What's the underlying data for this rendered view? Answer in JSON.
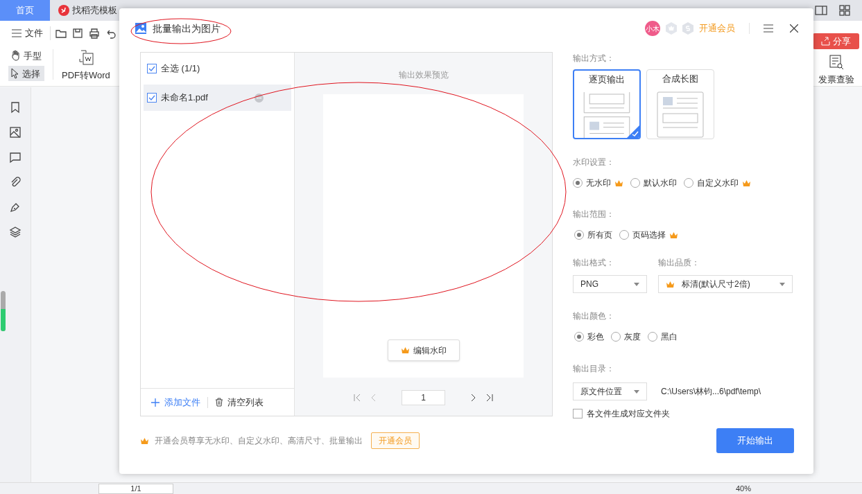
{
  "app": {
    "tabs": [
      {
        "label": "首页",
        "selected": true
      },
      {
        "label": "找稻壳模板",
        "selected": false
      }
    ],
    "menu": "文件",
    "tools": [
      {
        "label": "手型",
        "selected": false
      },
      {
        "label": "选择",
        "selected": true
      }
    ],
    "convert": "PDF转Word",
    "share": "分享",
    "invoice": "发票查验",
    "status_bar": {
      "page": "1/1",
      "zoom": "40%"
    }
  },
  "dialog": {
    "title": "批量输出为图片",
    "avatar": "小木",
    "vip_link": "开通会员",
    "file_list": {
      "select_all": {
        "label": "全选 (1/1)",
        "checked": true
      },
      "files": [
        {
          "name": "未命名1.pdf",
          "checked": true,
          "selected": true
        }
      ],
      "add": "添加文件",
      "clear": "清空列表"
    },
    "preview": {
      "title": "输出效果预览",
      "watermark_button": "编辑水印",
      "page": "1"
    },
    "settings": {
      "output_mode": {
        "label": "输出方式：",
        "options": [
          {
            "label": "逐页输出",
            "kind": "pages",
            "selected": true
          },
          {
            "label": "合成长图",
            "kind": "long",
            "selected": false
          }
        ]
      },
      "watermark": {
        "label": "水印设置：",
        "options": [
          {
            "label": "无水印",
            "vip": true,
            "selected": true
          },
          {
            "label": "默认水印",
            "vip": false,
            "selected": false
          },
          {
            "label": "自定义水印",
            "vip": true,
            "selected": false
          }
        ]
      },
      "range": {
        "label": "输出范围：",
        "options": [
          {
            "label": "所有页",
            "vip": false,
            "selected": true
          },
          {
            "label": "页码选择",
            "vip": true,
            "selected": false
          }
        ]
      },
      "format": {
        "label": "输出格式：",
        "value": "PNG"
      },
      "quality": {
        "label": "输出品质：",
        "value": "标清(默认尺寸2倍)",
        "vip": true
      },
      "color": {
        "label": "输出颜色：",
        "options": [
          {
            "label": "彩色",
            "vip": false,
            "selected": true
          },
          {
            "label": "灰度",
            "vip": false,
            "selected": false
          },
          {
            "label": "黑白",
            "vip": false,
            "selected": false
          }
        ]
      },
      "directory": {
        "label": "输出目录：",
        "value": "原文件位置",
        "path": "C:\\Users\\林钧...6\\pdf\\temp\\"
      },
      "subfolder": {
        "label": "各文件生成对应文件夹",
        "checked": false
      }
    },
    "footer": {
      "promo": "开通会员尊享无水印、自定义水印、高清尺寸、批量输出",
      "vip_button": "开通会员",
      "start_button": "开始输出"
    }
  }
}
